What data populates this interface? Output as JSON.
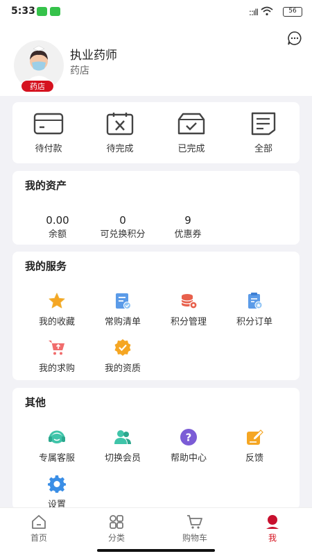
{
  "status": {
    "time": "5:33",
    "signal": "::ıll",
    "battery": "56"
  },
  "profile": {
    "name": "执业药师",
    "shop": "药店",
    "badge": "药店"
  },
  "orders": [
    {
      "label": "待付款",
      "icon": "wallet-card-icon"
    },
    {
      "label": "待完成",
      "icon": "calendar-x-icon"
    },
    {
      "label": "已完成",
      "icon": "box-check-icon"
    },
    {
      "label": "全部",
      "icon": "document-list-icon"
    }
  ],
  "assets": {
    "title": "我的资产",
    "items": [
      {
        "value": "0.00",
        "label": "余额"
      },
      {
        "value": "0",
        "label": "可兑换积分"
      },
      {
        "value": "9",
        "label": "优惠券"
      }
    ]
  },
  "services": {
    "title": "我的服务",
    "items": [
      {
        "label": "我的收藏",
        "icon": "star-icon"
      },
      {
        "label": "常购清单",
        "icon": "list-check-icon"
      },
      {
        "label": "积分管理",
        "icon": "coins-icon"
      },
      {
        "label": "积分订单",
        "icon": "order-star-icon"
      },
      {
        "label": "我的求购",
        "icon": "cart-upload-icon"
      },
      {
        "label": "我的资质",
        "icon": "badge-check-icon"
      }
    ]
  },
  "other": {
    "title": "其他",
    "items": [
      {
        "label": "专属客服",
        "icon": "headset-icon"
      },
      {
        "label": "切换会员",
        "icon": "users-icon"
      },
      {
        "label": "帮助中心",
        "icon": "help-icon"
      },
      {
        "label": "反馈",
        "icon": "edit-note-icon"
      },
      {
        "label": "设置",
        "icon": "gear-icon"
      }
    ]
  },
  "tabs": [
    {
      "label": "首页",
      "icon": "home-icon"
    },
    {
      "label": "分类",
      "icon": "grid-icon"
    },
    {
      "label": "购物车",
      "icon": "cart-icon"
    },
    {
      "label": "我",
      "icon": "profile-icon",
      "active": true
    }
  ],
  "colors": {
    "accent": "#d5121f",
    "star": "#f5a623",
    "blue": "#4a90e2",
    "teal": "#3fc4a9",
    "purple": "#7b5cd6"
  }
}
